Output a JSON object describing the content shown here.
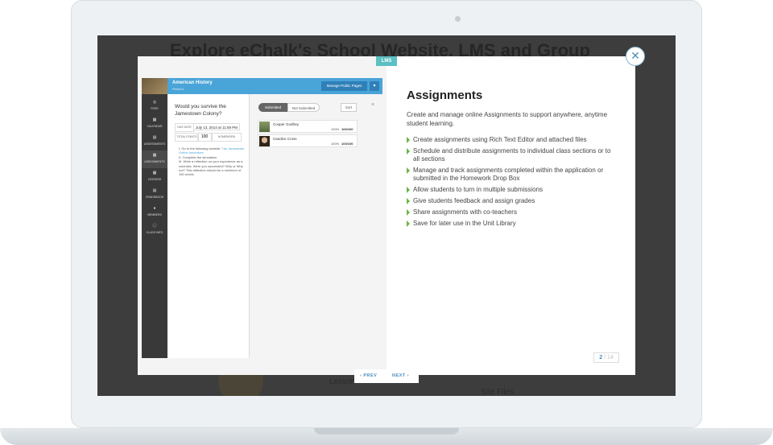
{
  "background_page": {
    "heading": "Explore eChalk's School Website, LMS and Group",
    "text_1": "Lesson",
    "text_2": "Site Files"
  },
  "modal": {
    "tag": "LMS",
    "close_icon": "close-icon",
    "screenshot": {
      "header": {
        "title": "American History",
        "subtitle": "Period 1",
        "manage_button": "Manage Public Pages",
        "menu_icon": "chevron-down-icon"
      },
      "sidebar": {
        "items": [
          {
            "label": "FEED",
            "icon": "feed-icon"
          },
          {
            "label": "CALENDAR",
            "icon": "calendar-icon"
          },
          {
            "label": "ASSESSMENTS",
            "icon": "assessments-icon"
          },
          {
            "label": "ASSIGNMENTS",
            "icon": "assignments-icon",
            "active": true
          },
          {
            "label": "LESSONS",
            "icon": "lessons-icon"
          },
          {
            "label": "GRADEBOOK",
            "icon": "gradebook-icon"
          },
          {
            "label": "MEMBERS",
            "icon": "members-icon"
          },
          {
            "label": "CLASS INFO",
            "icon": "info-icon"
          }
        ]
      },
      "detail": {
        "question": "Would you survive the Jamestown Colony?",
        "due_label": "DUE DATE",
        "due_value": "July 13, 2014 at 11:59 PM",
        "points_label": "TOTAL POINTS",
        "points_value": "100",
        "type": "HOMEWORK",
        "steps": [
          {
            "prefix": "I. Go to the following website: ",
            "link": "The Jamestown Online Adventure"
          },
          {
            "prefix": "II. Complete the simulation",
            "link": ""
          },
          {
            "prefix": "III. Write a reflection on your experience as a colonists. Were you successful? Why or Why not? This reflection should be a minimum of 150 words.",
            "link": ""
          }
        ]
      },
      "submissions": {
        "tab_submitted": "Submitted",
        "tab_not_submitted": "Not Submitted",
        "sort_label": "Sort",
        "close_label": "×",
        "students": [
          {
            "name": "Cooper Godfrey",
            "percent": "100%",
            "score": "100/100"
          },
          {
            "name": "Candice Cross",
            "percent": "100%",
            "score": "100/100"
          }
        ]
      }
    },
    "content": {
      "title": "Assignments",
      "description": "Create and manage online Assignments to support anywhere, anytime student learning.",
      "features": [
        "Create assignments using Rich Text Editor and attached files",
        "Schedule and distribute assignments to individual class sections or to all sections",
        "Manage and track assignments completed within the application or submitted in the Homework Drop Box",
        "Allow students to turn in multiple submissions",
        "Give students feedback and assign grades",
        "Share assignments with co-teachers",
        "Save for later use in the Unit Library"
      ],
      "pager_current": "2",
      "pager_total": "/ 14"
    },
    "nav": {
      "prev": "PREV",
      "next": "NEXT"
    }
  },
  "colors": {
    "accent": "#49a4d8",
    "lms_tag": "#5bc0c3",
    "bullet": "#6bb545",
    "sidebar": "#393939"
  }
}
